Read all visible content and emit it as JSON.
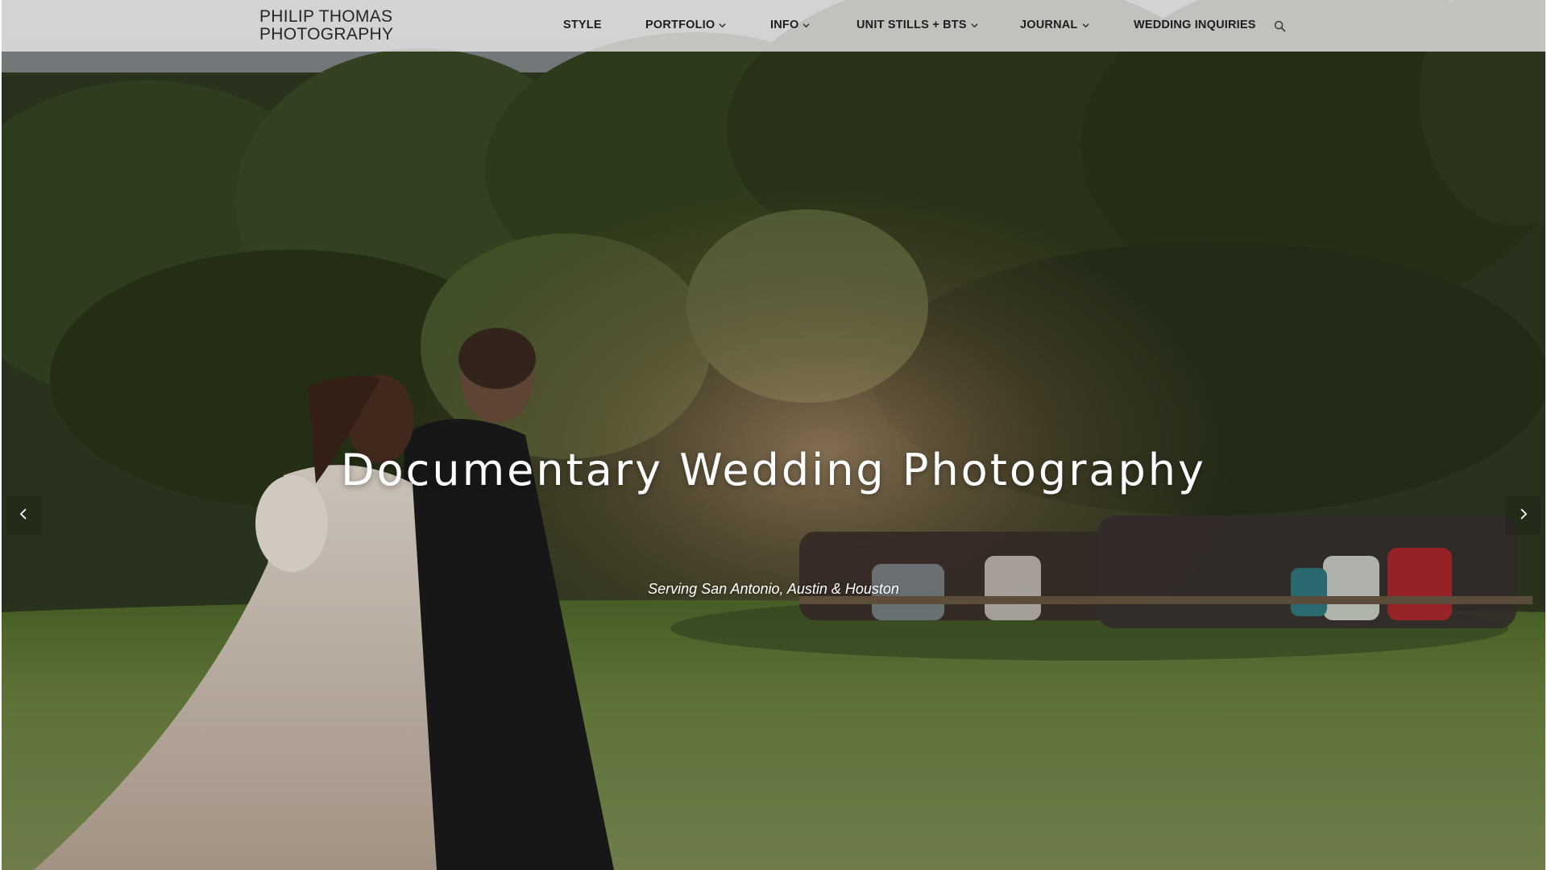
{
  "header": {
    "logo_line1": "PHILIP THOMAS",
    "logo_line2": "PHOTOGRAPHY"
  },
  "nav": {
    "items": [
      {
        "label": "STYLE",
        "has_dropdown": false
      },
      {
        "label": "PORTFOLIO",
        "has_dropdown": true
      },
      {
        "label": "INFO",
        "has_dropdown": true
      },
      {
        "label": "UNIT STILLS + BTS",
        "has_dropdown": true
      },
      {
        "label": "JOURNAL",
        "has_dropdown": true
      },
      {
        "label": "WEDDING INQUIRIES",
        "has_dropdown": false
      }
    ],
    "search_icon": "search-icon",
    "dropdown_icon": "chevron-down-icon"
  },
  "hero": {
    "title": "Documentary Wedding Photography",
    "subtitle": "Serving San Antonio, Austin & Houston",
    "prev_icon": "chevron-left-icon",
    "next_icon": "chevron-right-icon"
  },
  "colors": {
    "header_bg": "#ececec",
    "nav_text": "#1e1e1e",
    "logo_text": "#262626",
    "hero_text": "#ffffff",
    "foliage": "#2f3d1f",
    "lawn": "#667a3c"
  }
}
